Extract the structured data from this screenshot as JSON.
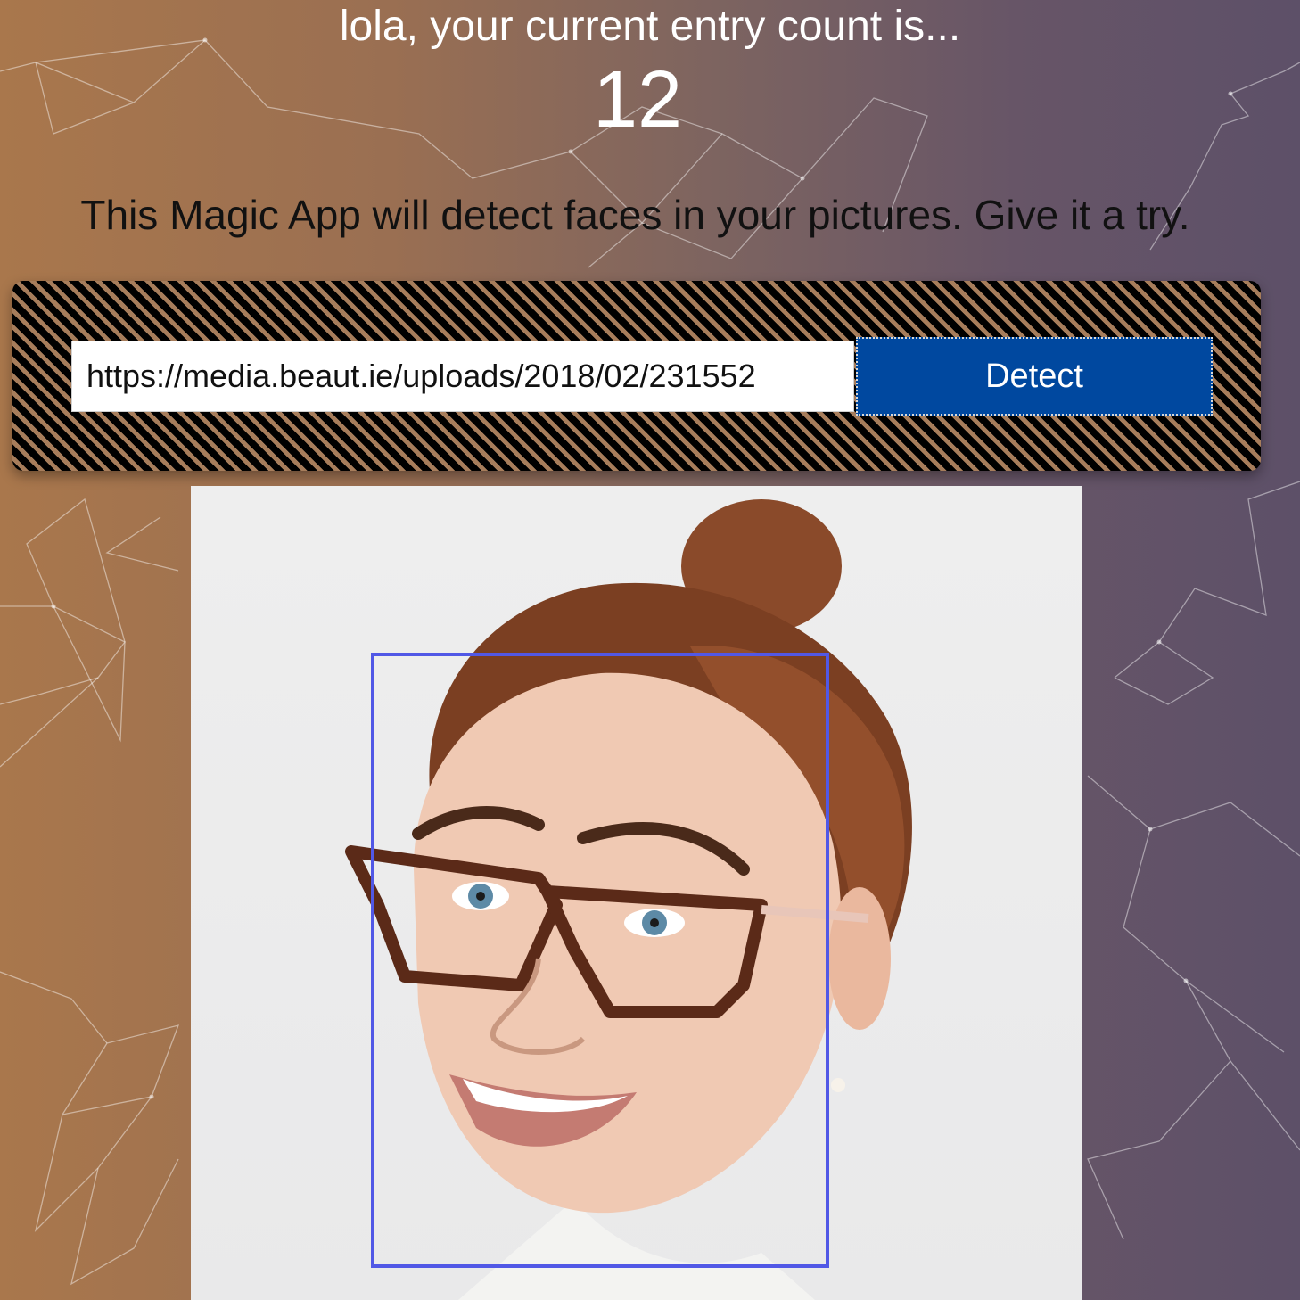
{
  "header": {
    "greeting": "lola, your current entry count is...",
    "entry_count": "12"
  },
  "description": "This Magic App will detect faces in your pictures. Give it a try.",
  "form": {
    "url_value": "https://media.beaut.ie/uploads/2018/02/231552",
    "detect_label": "Detect"
  },
  "result": {
    "faces_detected": 1
  },
  "colors": {
    "button": "#00489f",
    "face_box": "#5158e6",
    "background_left": "#a9774c",
    "background_right": "#5d5068"
  }
}
